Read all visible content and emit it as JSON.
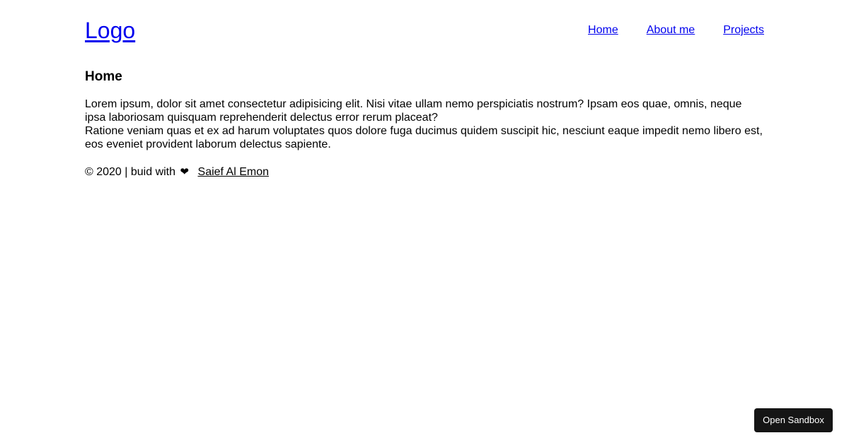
{
  "header": {
    "logo": "Logo",
    "nav": [
      {
        "label": "Home"
      },
      {
        "label": "About me"
      },
      {
        "label": "Projects"
      }
    ]
  },
  "main": {
    "title": "Home",
    "paragraph_1": "Lorem ipsum, dolor sit amet consectetur adipisicing elit. Nisi vitae ullam nemo perspiciatis nostrum? Ipsam eos quae, omnis, neque ipsa laboriosam quisquam reprehenderit delectus error rerum placeat?",
    "paragraph_2": "Ratione veniam quas et ex ad harum voluptates quos dolore fuga ducimus quidem suscipit hic, nesciunt eaque impedit nemo libero est, eos eveniet provident laborum delectus sapiente."
  },
  "footer": {
    "copyright": "© 2020 | buid with",
    "heart": "❤",
    "author": "Saief Al Emon"
  },
  "sandbox_button": {
    "label": "Open Sandbox"
  },
  "colors": {
    "link": "#0000ee",
    "text": "#000000",
    "button_bg": "#151515"
  }
}
